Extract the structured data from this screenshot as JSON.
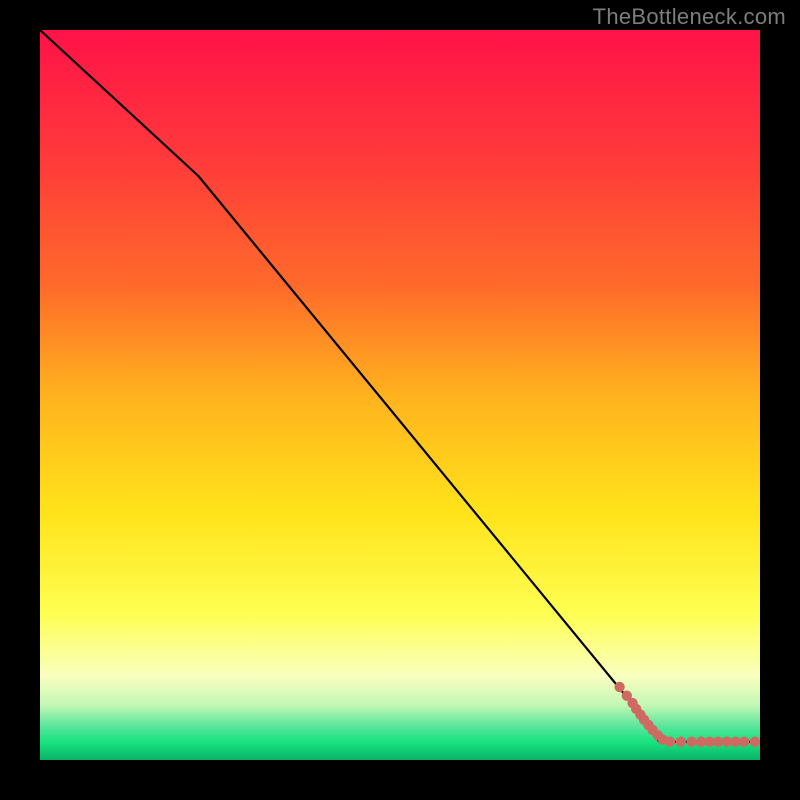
{
  "attribution": "TheBottleneck.com",
  "colors": {
    "bg": "#000000",
    "gradient_top": "#ff1248",
    "gradient_mid1": "#ff6a2a",
    "gradient_mid2": "#ffb21e",
    "gradient_mid3": "#ffe31a",
    "gradient_bottom_pale": "#f9ffbf",
    "gradient_green": "#19e37f",
    "curve": "#000000",
    "points": "#cf6a62"
  },
  "chart_data": {
    "type": "line",
    "title": "",
    "xlabel": "",
    "ylabel": "",
    "xlim": [
      0,
      100
    ],
    "ylim": [
      0,
      100
    ],
    "curve": [
      {
        "x": 0,
        "y": 100
      },
      {
        "x": 22,
        "y": 80
      },
      {
        "x": 82,
        "y": 8
      },
      {
        "x": 86,
        "y": 2.5
      },
      {
        "x": 100,
        "y": 2.5
      }
    ],
    "series": [
      {
        "name": "samples",
        "points": [
          {
            "x": 80.5,
            "y": 10.0
          },
          {
            "x": 81.5,
            "y": 8.8
          },
          {
            "x": 82.3,
            "y": 7.8
          },
          {
            "x": 82.8,
            "y": 7.0
          },
          {
            "x": 83.4,
            "y": 6.2
          },
          {
            "x": 83.9,
            "y": 5.5
          },
          {
            "x": 84.5,
            "y": 4.8
          },
          {
            "x": 85.1,
            "y": 4.1
          },
          {
            "x": 85.8,
            "y": 3.4
          },
          {
            "x": 86.5,
            "y": 2.8
          },
          {
            "x": 87.5,
            "y": 2.5
          },
          {
            "x": 89.0,
            "y": 2.5
          },
          {
            "x": 90.5,
            "y": 2.5
          },
          {
            "x": 91.8,
            "y": 2.5
          },
          {
            "x": 93.0,
            "y": 2.5
          },
          {
            "x": 94.2,
            "y": 2.5
          },
          {
            "x": 95.4,
            "y": 2.5
          },
          {
            "x": 96.6,
            "y": 2.5
          },
          {
            "x": 97.8,
            "y": 2.5
          },
          {
            "x": 99.3,
            "y": 2.5
          }
        ]
      }
    ]
  }
}
